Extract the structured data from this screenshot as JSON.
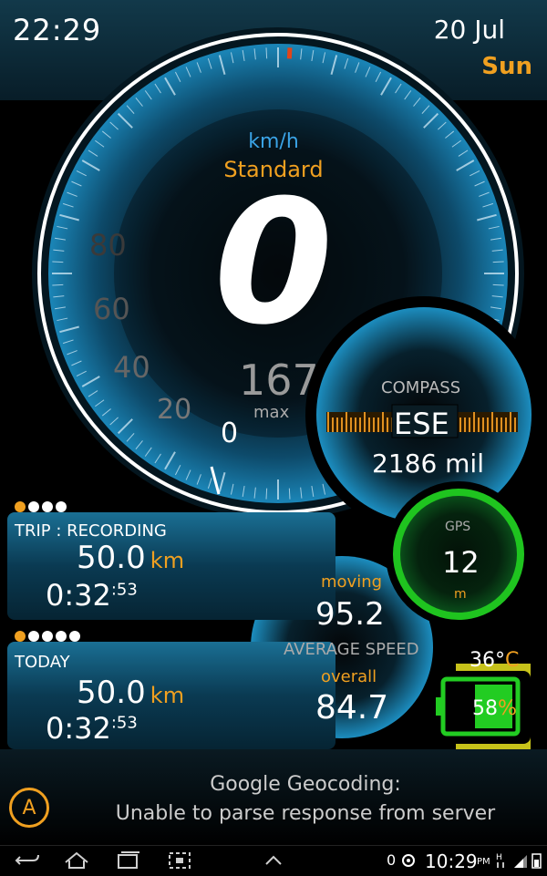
{
  "status": {
    "time": "22:29",
    "date": "20 Jul",
    "day": "Sun"
  },
  "speedometer": {
    "unit": "km/h",
    "mode": "Standard",
    "speed": "0",
    "max_value": "167",
    "max_label": "max",
    "dial_labels": [
      "80",
      "60",
      "40",
      "20",
      "0"
    ]
  },
  "compass": {
    "label": "COMPASS",
    "direction": "ESE",
    "reading": "2186 mil"
  },
  "gps": {
    "label": "GPS",
    "value": "12",
    "unit": "m"
  },
  "trip": {
    "label": "TRIP : RECORDING",
    "distance": "50.0",
    "unit": "km",
    "duration": "0:32",
    "seconds": ":53",
    "pages": 4,
    "active_page": 3
  },
  "today": {
    "label": "TODAY",
    "distance": "50.0",
    "unit": "km",
    "duration": "0:32",
    "seconds": ":53",
    "pages": 5,
    "active_page": 4
  },
  "average": {
    "moving_label": "moving",
    "moving_value": "95.2",
    "label": "AVERAGE SPEED",
    "overall_label": "overall",
    "overall_value": "84.7"
  },
  "battery": {
    "temperature": "36°",
    "temp_unit": "C",
    "percent": "58",
    "percent_sign": "%",
    "level": 0.58
  },
  "message": {
    "line1": "Google Geocoding:",
    "line2": "Unable to parse response from server"
  },
  "a_button": "A",
  "navbar": {
    "zero": "0",
    "clock": "10:29",
    "ampm": "PM"
  },
  "colors": {
    "accent": "#f0a020",
    "blue": "#3aa3e6",
    "gps_green": "#22cc22"
  }
}
